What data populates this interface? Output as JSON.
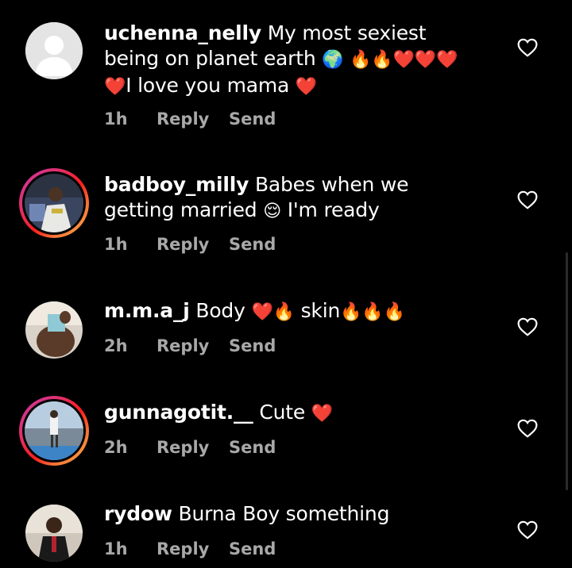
{
  "comments": [
    {
      "username": "uchenna_nelly",
      "text_parts": [
        "My most sexiest being on planet earth ",
        "🌍",
        " ",
        "🔥🔥❤️❤️❤️❤️",
        "I love you mama ",
        "❤️"
      ],
      "time": "1h",
      "reply": "Reply",
      "send": "Send"
    },
    {
      "username": "badboy_milly",
      "text_parts": [
        "Babes when we getting married ",
        "😌",
        " I'm ready"
      ],
      "time": "1h",
      "reply": "Reply",
      "send": "Send"
    },
    {
      "username": "m.m.a_j",
      "text_parts": [
        "Body ",
        "❤️🔥",
        " skin",
        "🔥🔥🔥"
      ],
      "time": "2h",
      "reply": "Reply",
      "send": "Send"
    },
    {
      "username": "gunnagotit.__",
      "text_parts": [
        "Cute ",
        "❤️"
      ],
      "time": "2h",
      "reply": "Reply",
      "send": "Send"
    },
    {
      "username": "rydow",
      "text_parts": [
        "Burna Boy something"
      ],
      "time": "1h",
      "reply": "Reply",
      "send": "Send"
    }
  ],
  "icons": {
    "like": "heart-outline-icon"
  },
  "colors": {
    "background": "#000000",
    "text": "#ffffff",
    "meta": "#a8a8a8"
  }
}
